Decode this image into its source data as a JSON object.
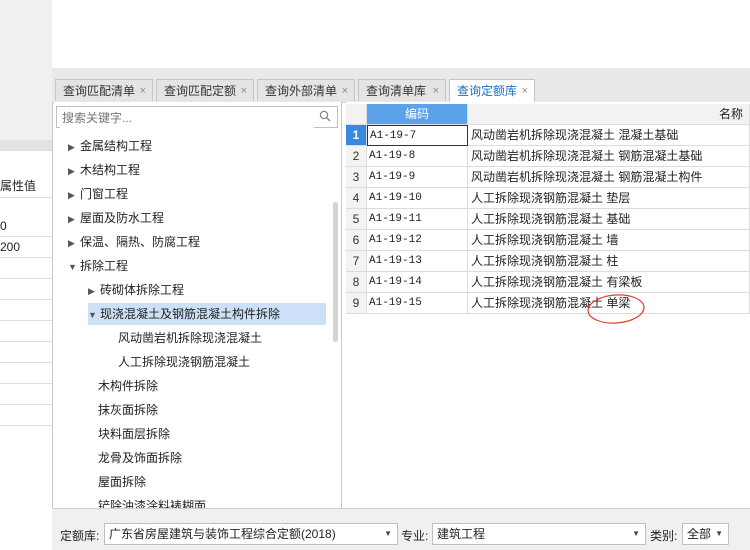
{
  "left_panel": {
    "header": "属性值",
    "values": [
      "0",
      "200"
    ]
  },
  "tabs": [
    {
      "label": "查询匹配清单",
      "close": "×"
    },
    {
      "label": "查询匹配定额",
      "close": "×"
    },
    {
      "label": "查询外部清单",
      "close": "×"
    },
    {
      "label": "查询清单库",
      "close": "×"
    },
    {
      "label": "查询定额库",
      "close": "×",
      "active": true
    }
  ],
  "search": {
    "placeholder": "搜索关键字..."
  },
  "tree": [
    {
      "label": "金属结构工程",
      "arrow": "▶"
    },
    {
      "label": "木结构工程",
      "arrow": "▶"
    },
    {
      "label": "门窗工程",
      "arrow": "▶"
    },
    {
      "label": "屋面及防水工程",
      "arrow": "▶"
    },
    {
      "label": "保温、隔热、防腐工程",
      "arrow": "▶"
    },
    {
      "label": "拆除工程",
      "arrow": "▼"
    },
    {
      "label": "砖砌体拆除工程",
      "arrow": "▶"
    },
    {
      "label": "现浇混凝土及钢筋混凝土构件拆除",
      "arrow": "▼",
      "selected": true
    },
    {
      "label": "风动凿岩机拆除现浇混凝土",
      "arrow": ""
    },
    {
      "label": "人工拆除现浇钢筋混凝土",
      "arrow": ""
    },
    {
      "label": "木构件拆除",
      "arrow": ""
    },
    {
      "label": "抹灰面拆除",
      "arrow": ""
    },
    {
      "label": "块料面层拆除",
      "arrow": ""
    },
    {
      "label": "龙骨及饰面拆除",
      "arrow": ""
    },
    {
      "label": "屋面拆除",
      "arrow": ""
    },
    {
      "label": "铲除油漆涂料裱糊面",
      "arrow": ""
    }
  ],
  "grid": {
    "columns": {
      "code": "编码",
      "name": "名称"
    },
    "rows": [
      {
        "num": "1",
        "code": "A1-19-7",
        "name": "风动凿岩机拆除现浇混凝土 混凝土基础"
      },
      {
        "num": "2",
        "code": "A1-19-8",
        "name": "风动凿岩机拆除现浇混凝土 钢筋混凝土基础"
      },
      {
        "num": "3",
        "code": "A1-19-9",
        "name": "风动凿岩机拆除现浇混凝土 钢筋混凝土构件"
      },
      {
        "num": "4",
        "code": "A1-19-10",
        "name": "人工拆除现浇钢筋混凝土 垫层"
      },
      {
        "num": "5",
        "code": "A1-19-11",
        "name": "人工拆除现浇钢筋混凝土 基础"
      },
      {
        "num": "6",
        "code": "A1-19-12",
        "name": "人工拆除现浇钢筋混凝土 墙"
      },
      {
        "num": "7",
        "code": "A1-19-13",
        "name": "人工拆除现浇钢筋混凝土 柱"
      },
      {
        "num": "8",
        "code": "A1-19-14",
        "name": "人工拆除现浇钢筋混凝土 有梁板"
      },
      {
        "num": "9",
        "code": "A1-19-15",
        "name": "人工拆除现浇钢筋混凝土 单梁"
      }
    ]
  },
  "bottom": {
    "quota_label": "定额库:",
    "quota_value": "广东省房屋建筑与装饰工程综合定额(2018)",
    "major_label": "专业:",
    "major_value": "建筑工程",
    "category_label": "类别:",
    "category_value": "全部"
  },
  "colors": {
    "accent": "#3a89e0",
    "annotation": "#e0403a",
    "selected_tree": "#cce1f7"
  }
}
